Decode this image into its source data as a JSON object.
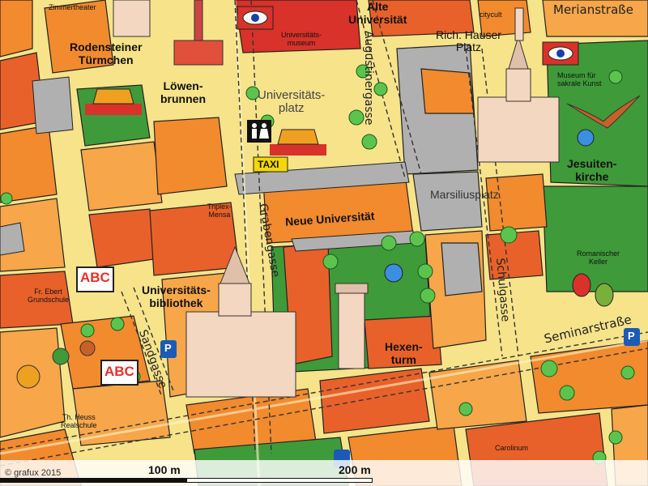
{
  "labels": {
    "zimmertheater": "Zimmertheater",
    "alte_universitaet": "Alte\nUniversität",
    "universitaetsmuseum": "Universitäts-\nmuseum",
    "cityculi": "citycult",
    "merianstrasse": "Merianstraße",
    "rich_hauser_platz": "Rich. Hauser\nPlatz",
    "rodensteiner_tuermchen": "Rodensteiner\nTürmchen",
    "loewenbrunnen": "Löwen-\nbrunnen",
    "universitaetsplatz": "Universitäts-\nplatz",
    "augustinergasse": "Augustinergasse",
    "museum_sakrale_kunst": "Museum für\nsakrale Kunst",
    "taxi": "TAXI",
    "jesuitenkirche": "Jesuiten-\nkirche",
    "marsiliusplatz": "Marsiliusplatz",
    "triplex_mensa": "Triplex-\nMensa",
    "grabengasse": "Grabengasse",
    "neue_universitaet": "Neue Universität",
    "romanischer_keller": "Romanischer\nKeller",
    "schulgasse": "Schulgasse",
    "universitaetsbibliothek": "Universitäts-\nbibliothek",
    "fr_ebert_grundschule": "Fr. Ebert\nGrundschule",
    "abc": "ABC",
    "sandgasse": "Sandgasse",
    "hexenturm": "Hexen-\nturm",
    "seminarstrasse": "Seminarstraße",
    "th_heuss_realschule": "Th. Heuss\nRealschule",
    "carolinum": "Carolinum",
    "parking_p1": "P",
    "parking_p2": "P"
  },
  "footer": {
    "copyright": "© grafux 2015",
    "scale_100": "100 m",
    "scale_200": "200 m"
  },
  "colors": {
    "road": "#f6e38a",
    "building_orange": "#f28a2e",
    "building_dark": "#e8612a",
    "building_light": "#f7a64a",
    "plaza_gray": "#b0b0b0",
    "park_green": "#3f9a3a",
    "water_blue": "#3a8fe0",
    "museum_red": "#d8322a"
  },
  "icons": [
    "eye-icon",
    "toilet-icon",
    "picnic-basket-icon",
    "taxi-icon",
    "abc-school-icon",
    "theater-masks-icon",
    "eagle-icon",
    "parking-icon",
    "tree-icon",
    "tower-icon",
    "church-icon",
    "fountain-icon"
  ]
}
